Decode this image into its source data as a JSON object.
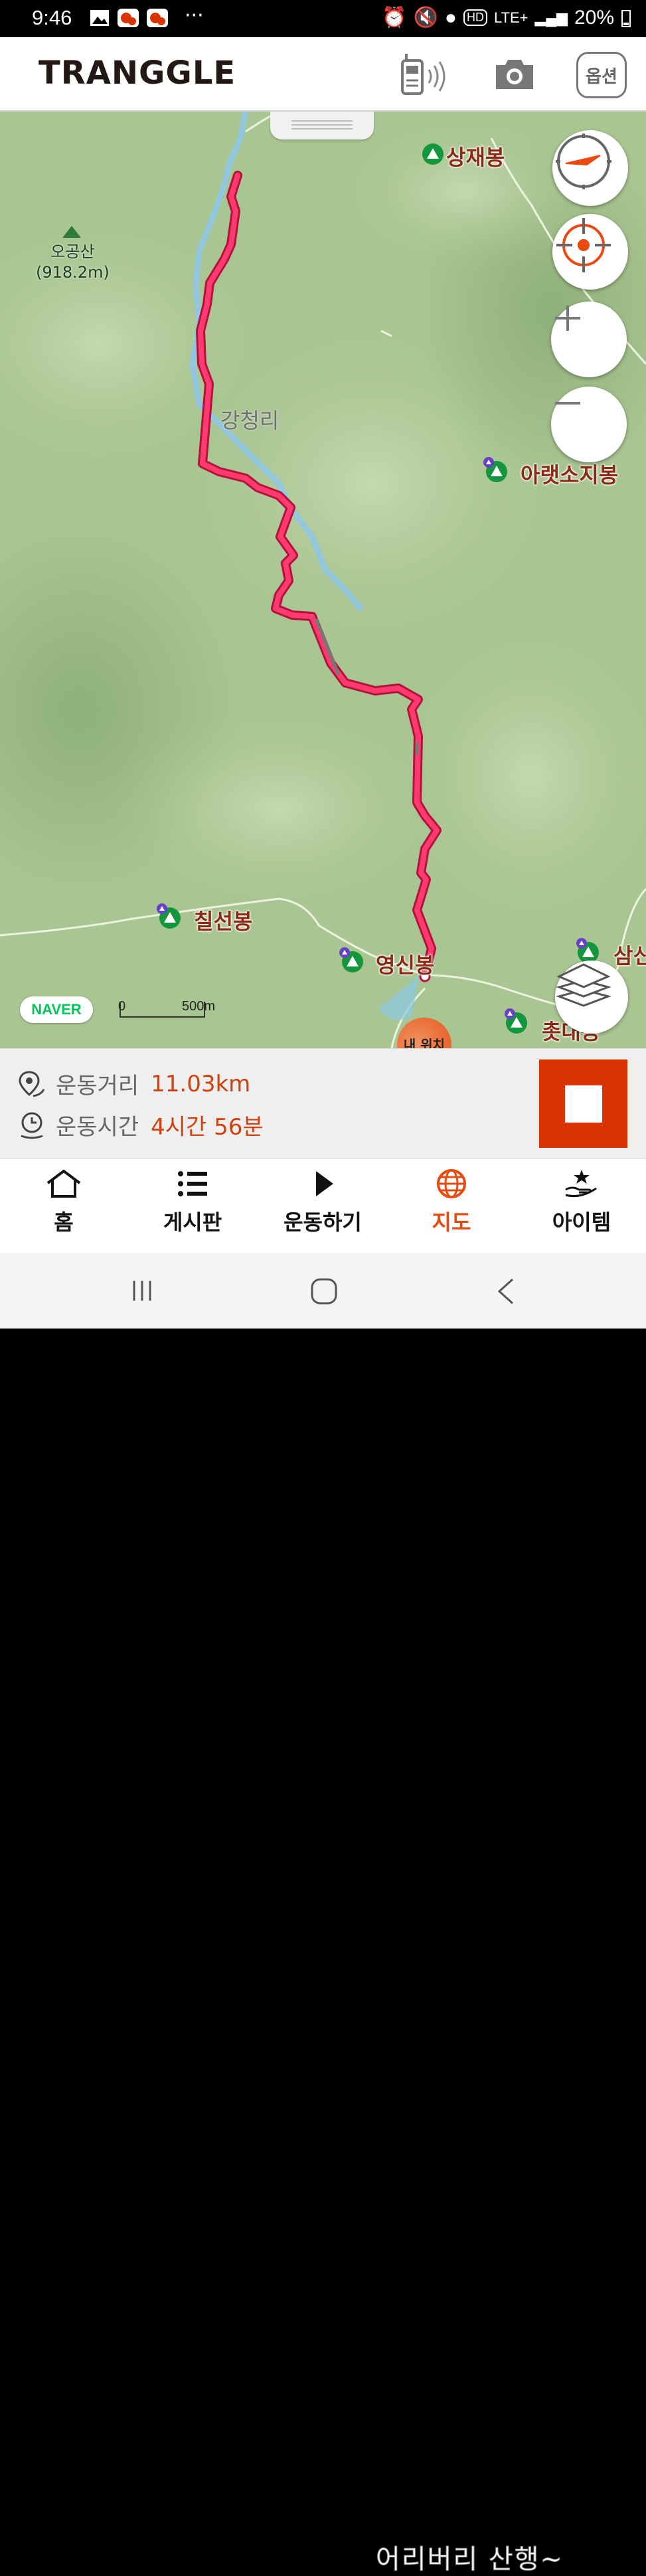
{
  "status_bar": {
    "time": "9:46",
    "network": "LTE+",
    "battery": "20%"
  },
  "header": {
    "logo": "TRANGGLE",
    "option_label": "옵션"
  },
  "map": {
    "labels": {
      "mountain_name": "오공산",
      "mountain_elev": "(918.2m)",
      "village": "강청리",
      "peak_top": "상재봉",
      "peak_right": "아랫소지봉",
      "peak_left": "칠선봉",
      "peak_bottom": "영신봉",
      "peak_right_bottom": "삼신",
      "peak_bottom_right": "촛대봉"
    },
    "my_location": "내 위치",
    "naver_logo": "NAVER",
    "scale_start": "0",
    "scale_end": "500m"
  },
  "stats": {
    "distance_label": "운동거리",
    "distance_value": "11.03km",
    "time_label": "운동시간",
    "time_value": "4시간 56분"
  },
  "tabs": [
    {
      "label": "홈",
      "icon": "home-icon"
    },
    {
      "label": "게시판",
      "icon": "list-icon"
    },
    {
      "label": "운동하기",
      "icon": "play-icon"
    },
    {
      "label": "지도",
      "icon": "globe-icon"
    },
    {
      "label": "아이템",
      "icon": "item-icon"
    }
  ],
  "watermark": "어리버리 산행~",
  "colors": {
    "accent": "#e84a10",
    "track": "#ff3a6e",
    "stop": "#d83300"
  }
}
